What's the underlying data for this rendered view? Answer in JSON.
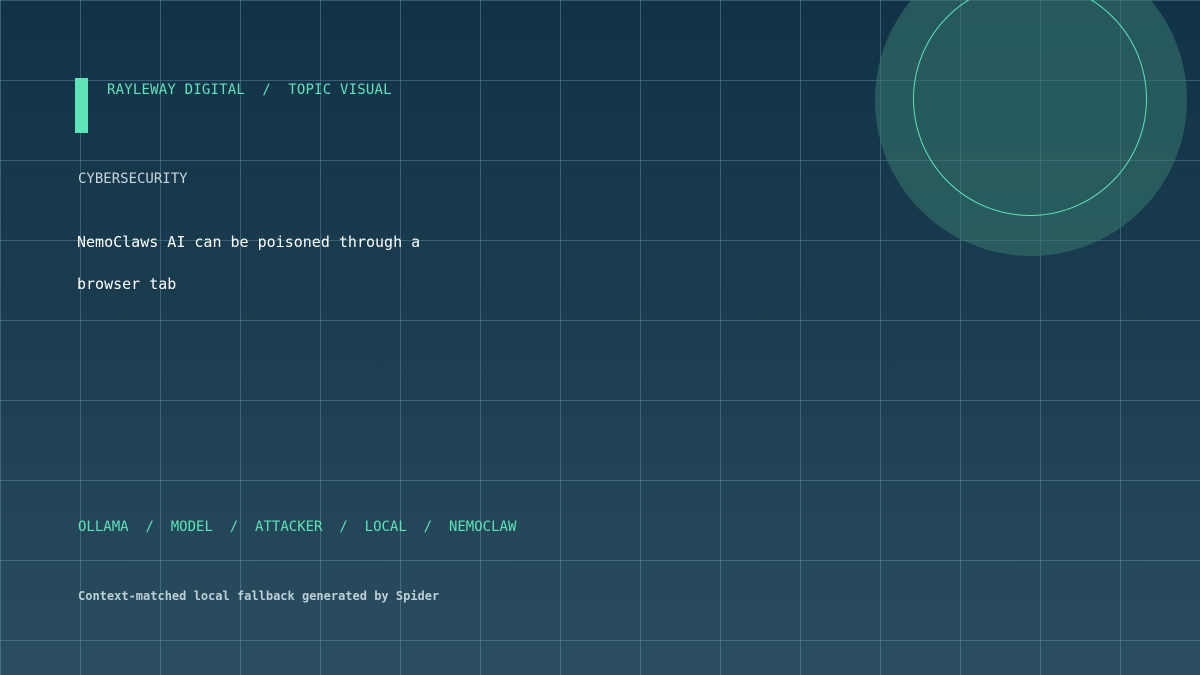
{
  "brand": {
    "name": "RAYLEWAY DIGITAL",
    "separator": "/",
    "section": "TOPIC VISUAL"
  },
  "topic": "CYBERSECURITY",
  "headline": {
    "line1": "NemoClaws AI can be poisoned through a",
    "line2": "browser tab"
  },
  "tags": [
    "OLLAMA",
    "MODEL",
    "ATTACKER",
    "LOCAL",
    "NEMOCLAW"
  ],
  "tag_separator": "/",
  "footer": "Context-matched local fallback generated by Spider",
  "colors": {
    "accent": "#5fe3b8",
    "background_top": "#123247",
    "background_bottom": "#2a4d60",
    "headline": "#ffffff"
  }
}
